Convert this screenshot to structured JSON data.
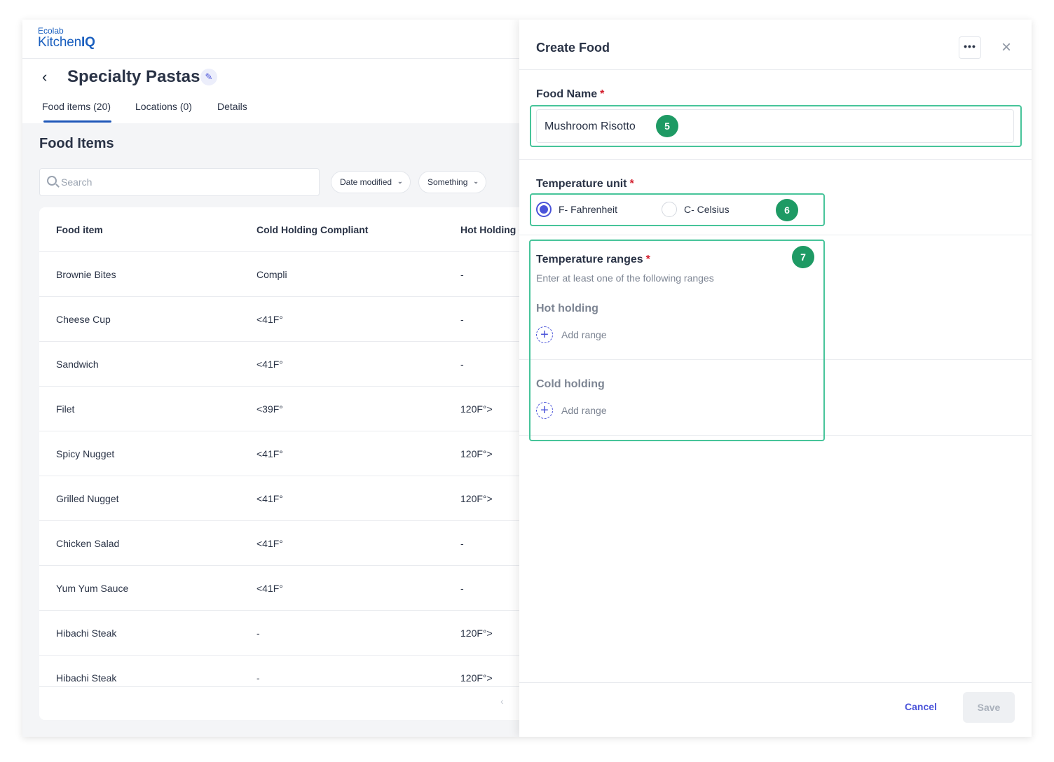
{
  "logo": {
    "line1": "Ecolab",
    "line2_a": "Kitchen",
    "line2_b": "IQ"
  },
  "page": {
    "back_icon": "chevron-left-icon",
    "title": "Specialty Pastas",
    "edit_icon": "pencil-icon",
    "tabs": [
      {
        "label": "Food items (20)",
        "active": true
      },
      {
        "label": "Locations (0)",
        "active": false
      },
      {
        "label": "Details",
        "active": false
      }
    ]
  },
  "list": {
    "section_title": "Food Items",
    "search_placeholder": "Search",
    "filters": [
      {
        "label": "Date modified"
      },
      {
        "label": "Something"
      }
    ],
    "columns": [
      "Food item",
      "Cold Holding Compliant",
      "Hot Holding C"
    ],
    "rows": [
      {
        "name": "Brownie Bites",
        "cold": "Compli",
        "hot": "-"
      },
      {
        "name": "Cheese Cup",
        "cold": "<41F°",
        "hot": "-"
      },
      {
        "name": "Sandwich",
        "cold": "<41F°",
        "hot": "-"
      },
      {
        "name": "Filet",
        "cold": "<39F°",
        "hot": "120F°>"
      },
      {
        "name": "Spicy Nugget",
        "cold": "<41F°",
        "hot": "120F°>"
      },
      {
        "name": "Grilled Nugget",
        "cold": "<41F°",
        "hot": "120F°>"
      },
      {
        "name": "Chicken Salad",
        "cold": "<41F°",
        "hot": "-"
      },
      {
        "name": "Yum Yum Sauce",
        "cold": "<41F°",
        "hot": "-"
      },
      {
        "name": "Hibachi Steak",
        "cold": "-",
        "hot": "120F°>"
      },
      {
        "name": "Hibachi Steak",
        "cold": "-",
        "hot": "120F°>"
      }
    ],
    "pager_prev": "‹"
  },
  "drawer": {
    "title": "Create Food",
    "more_label": "•••",
    "close_label": "×",
    "food_name_label": "Food Name",
    "required_mark": "*",
    "food_name_value": "Mushroom Risotto",
    "temp_unit_label": "Temperature unit",
    "units": [
      {
        "label": "F- Fahrenheit",
        "selected": true
      },
      {
        "label": "C- Celsius",
        "selected": false
      }
    ],
    "ranges_label": "Temperature ranges",
    "ranges_help": "Enter at least one of the following ranges",
    "hot_holding_label": "Hot holding",
    "cold_holding_label": "Cold holding",
    "add_range_label": "Add range",
    "cancel_label": "Cancel",
    "save_label": "Save"
  },
  "annotations": [
    {
      "number": "5"
    },
    {
      "number": "6"
    },
    {
      "number": "7"
    }
  ],
  "colors": {
    "accent": "#4b54d9",
    "brand": "#1a5fbf",
    "annotation_border": "#47c49a",
    "annotation_badge": "#1e9a64",
    "required": "#d3202f"
  }
}
